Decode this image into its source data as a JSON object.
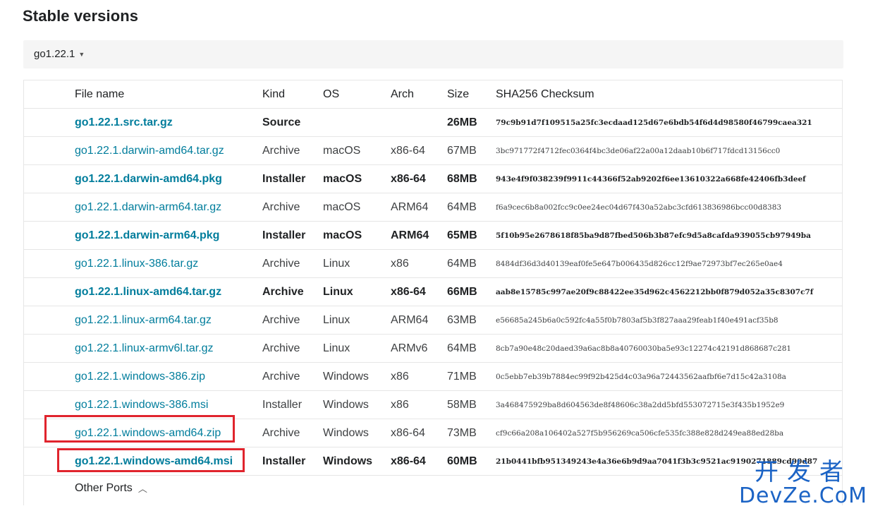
{
  "section_title": "Stable versions",
  "version_selector": {
    "value": "go1.22.1",
    "caret_icon": "chevron-down-icon"
  },
  "table": {
    "headers": {
      "file_name": "File name",
      "kind": "Kind",
      "os": "OS",
      "arch": "Arch",
      "size": "Size",
      "checksum": "SHA256 Checksum"
    },
    "rows": [
      {
        "file": "go1.22.1.src.tar.gz",
        "kind": "Source",
        "os": "",
        "arch": "",
        "size": "26MB",
        "sha": "79c9b91d7f109515a25fc3ecdaad125d67e6bdb54f6d4d98580f46799caea321",
        "highlight": true
      },
      {
        "file": "go1.22.1.darwin-amd64.tar.gz",
        "kind": "Archive",
        "os": "macOS",
        "arch": "x86-64",
        "size": "67MB",
        "sha": "3bc971772f4712fec0364f4bc3de06af22a00a12daab10b6f717fdcd13156cc0",
        "highlight": false
      },
      {
        "file": "go1.22.1.darwin-amd64.pkg",
        "kind": "Installer",
        "os": "macOS",
        "arch": "x86-64",
        "size": "68MB",
        "sha": "943e4f9f038239f9911c44366f52ab9202f6ee13610322a668fe42406fb3deef",
        "highlight": true
      },
      {
        "file": "go1.22.1.darwin-arm64.tar.gz",
        "kind": "Archive",
        "os": "macOS",
        "arch": "ARM64",
        "size": "64MB",
        "sha": "f6a9cec6b8a002fcc9c0ee24ec04d67f430a52abc3cfd613836986bcc00d8383",
        "highlight": false
      },
      {
        "file": "go1.22.1.darwin-arm64.pkg",
        "kind": "Installer",
        "os": "macOS",
        "arch": "ARM64",
        "size": "65MB",
        "sha": "5f10b95e2678618f85ba9d87fbed506b3b87efc9d5a8cafda939055cb97949ba",
        "highlight": true
      },
      {
        "file": "go1.22.1.linux-386.tar.gz",
        "kind": "Archive",
        "os": "Linux",
        "arch": "x86",
        "size": "64MB",
        "sha": "8484df36d3d40139eaf0fe5e647b006435d826cc12f9ae72973bf7ec265e0ae4",
        "highlight": false
      },
      {
        "file": "go1.22.1.linux-amd64.tar.gz",
        "kind": "Archive",
        "os": "Linux",
        "arch": "x86-64",
        "size": "66MB",
        "sha": "aab8e15785c997ae20f9c88422ee35d962c4562212bb0f879d052a35c8307c7f",
        "highlight": true
      },
      {
        "file": "go1.22.1.linux-arm64.tar.gz",
        "kind": "Archive",
        "os": "Linux",
        "arch": "ARM64",
        "size": "63MB",
        "sha": "e56685a245b6a0c592fc4a55f0b7803af5b3f827aaa29feab1f40e491acf35b8",
        "highlight": false
      },
      {
        "file": "go1.22.1.linux-armv6l.tar.gz",
        "kind": "Archive",
        "os": "Linux",
        "arch": "ARMv6",
        "size": "64MB",
        "sha": "8cb7a90e48c20daed39a6ac8b8a40760030ba5e93c12274c42191d868687c281",
        "highlight": false
      },
      {
        "file": "go1.22.1.windows-386.zip",
        "kind": "Archive",
        "os": "Windows",
        "arch": "x86",
        "size": "71MB",
        "sha": "0c5ebb7eb39b7884ec99f92b425d4c03a96a72443562aafbf6e7d15c42a3108a",
        "highlight": false
      },
      {
        "file": "go1.22.1.windows-386.msi",
        "kind": "Installer",
        "os": "Windows",
        "arch": "x86",
        "size": "58MB",
        "sha": "3a468475929ba8d604563de8f48606c38a2dd5bfd553072715e3f435b1952e9",
        "highlight": false
      },
      {
        "file": "go1.22.1.windows-amd64.zip",
        "kind": "Archive",
        "os": "Windows",
        "arch": "x86-64",
        "size": "73MB",
        "sha": "cf9c66a208a106402a527f5b956269ca506cfe535fc388e828d249ea88ed28ba",
        "highlight": false
      },
      {
        "file": "go1.22.1.windows-amd64.msi",
        "kind": "Installer",
        "os": "Windows",
        "arch": "x86-64",
        "size": "60MB",
        "sha": "21b0441bfb951349243e4a36e6b9d9aa7041f3b3c9521ac9190271889cd90d87",
        "highlight": true
      }
    ]
  },
  "other_ports": {
    "label": "Other Ports",
    "icon": "chevron-up-icon"
  },
  "watermark": {
    "line1": "开发者",
    "line2": "DevZe.CoM"
  },
  "colors": {
    "link": "#007d9c",
    "annotation": "#e0242d",
    "watermark": "#1b63c5"
  }
}
